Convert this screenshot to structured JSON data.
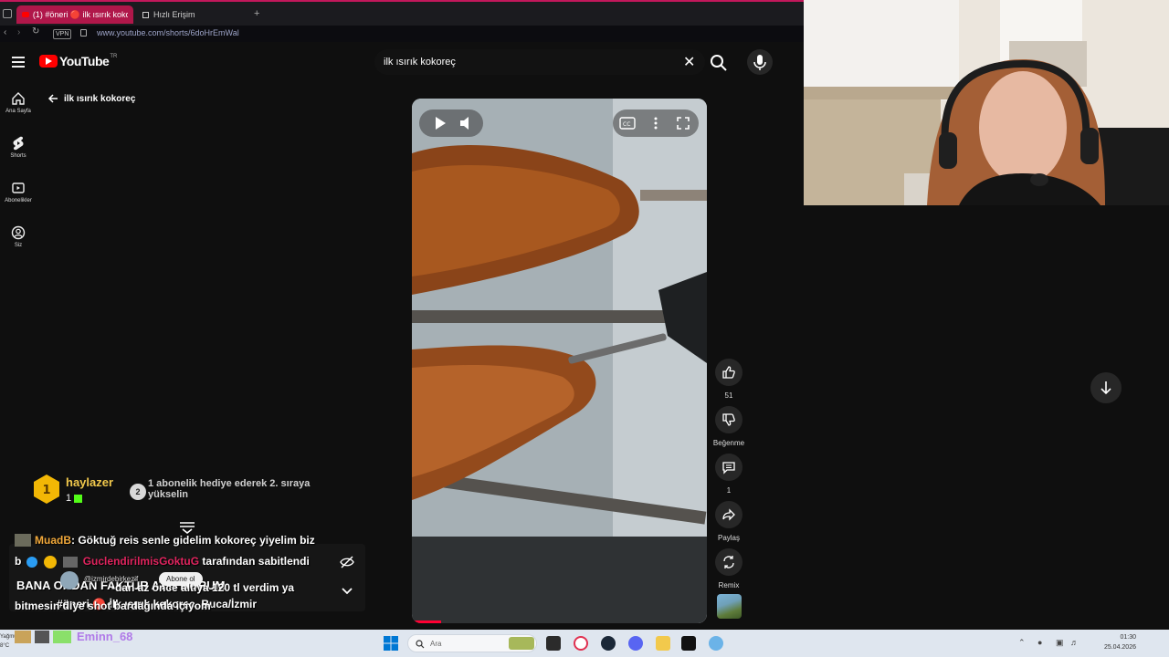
{
  "browser": {
    "tabs": [
      {
        "label": "(1) #öneri 🔴 ilk ısırık koko"
      },
      {
        "label": "Hızlı Erişim"
      }
    ],
    "new_tab": "+",
    "vpn": "VPN",
    "url": "www.youtube.com/shorts/6doHrEmWal"
  },
  "youtube": {
    "logo_text": "YouTube",
    "country_code": "TR",
    "search_query": "ilk ısırık kokoreç",
    "nav": [
      {
        "label": "Ana Sayfa"
      },
      {
        "label": "Shorts"
      },
      {
        "label": "Abonelikler"
      },
      {
        "label": "Siz"
      }
    ],
    "back_title": "ilk ısırık kokoreç",
    "actions": {
      "like_count": "51",
      "dislike_label": "Beğenme",
      "comment_count": "1",
      "share_label": "Paylaş",
      "remix_label": "Remix"
    },
    "progress_fraction": 0.1
  },
  "stream_overlay": {
    "top_sub": {
      "rank": "1",
      "user": "haylazer",
      "count": "1"
    },
    "gift_rank": "2",
    "gift_promo": "1 abonelik hediye ederek 2. sıraya yükselin",
    "chat": {
      "user": "MuadB",
      "message": ": Göktuğ reis senle gidelim kokoreç yiyelim biz",
      "pin_prefix": "b",
      "pin_user": "GuclendirilmisGoktuG",
      "pin_suffix": "tarafından sabitlendi",
      "pin_line2": "BANA ORDAN FAKTÜR ATTI BORUM",
      "pin_line3": "bitmesin diye shot bardağında içiyom",
      "pin_mid": "-dan az önce altıya 120 tl verdim ya",
      "subscribe_btn": "Abone ol",
      "handle": "@izmirdebirkezif",
      "title_line": "#öneri 🔴 İlk ısırık kokoreç, Buca/İzmir"
    }
  },
  "taskbar": {
    "weather": "Yağmurlu",
    "temp": "8°C",
    "search_placeholder": "Ara",
    "chat_user": "Eminn_68",
    "time": "01:30",
    "date": "25.04.2026"
  },
  "colors": {
    "accent_tab": "#b0174a",
    "youtube_red": "#ff0000",
    "sub_user": "#f2c94c",
    "pin_user": "#e0245e",
    "chat_user": "#f2a93b"
  }
}
